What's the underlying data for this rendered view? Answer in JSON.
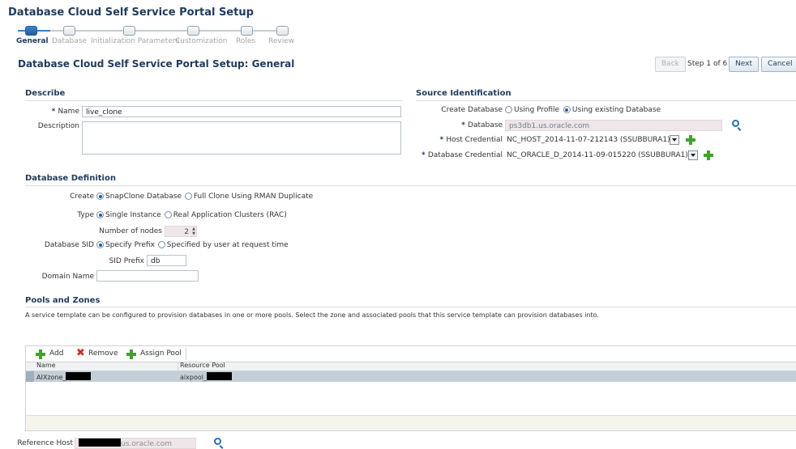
{
  "page": {
    "title": "Database Cloud Self Service Portal Setup",
    "subtitle": "Database Cloud Self Service Portal Setup: General"
  },
  "train": {
    "steps": [
      "General",
      "Database",
      "Initialization Parameters",
      "Customization",
      "Roles",
      "Review"
    ],
    "active": 0
  },
  "nav": {
    "back": "Back",
    "step": "Step 1 of 6",
    "next": "Next",
    "cancel": "Cancel"
  },
  "describe": {
    "heading": "Describe",
    "name_label": "Name",
    "name_value": "live_clone",
    "description_label": "Description",
    "description_value": ""
  },
  "source": {
    "heading": "Source Identification",
    "create_label": "Create Database",
    "opt_profile": "Using Profile",
    "opt_existing": "Using existing Database",
    "database_label": "Database",
    "database_value": "ps3db1.us.oracle.com",
    "host_cred_label": "Host Credential",
    "host_cred_value": "NC_HOST_2014-11-07-212143 (SSUBBURA1)",
    "db_cred_label": "Database Credential",
    "db_cred_value": "NC_ORACLE_D_2014-11-09-015220 (SSUBBURA1)"
  },
  "definition": {
    "heading": "Database Definition",
    "create_label": "Create",
    "create_opt1": "SnapClone Database",
    "create_opt2": "Full Clone Using RMAN Duplicate",
    "type_label": "Type",
    "type_opt1": "Single Instance",
    "type_opt2": "Real Application Clusters (RAC)",
    "nodes_label": "Number of nodes",
    "nodes_value": "2",
    "sid_label": "Database SID",
    "sid_opt1": "Specify Prefix",
    "sid_opt2": "Specified by user at request time",
    "sid_prefix_label": "SID Prefix",
    "sid_prefix_value": "db",
    "domain_label": "Domain Name",
    "domain_value": ""
  },
  "pools": {
    "heading": "Pools and Zones",
    "description": "A service template can be configured to provision databases in one or more pools. Select the zone and associated pools that this service template can provision databases into.",
    "add": "Add",
    "remove": "Remove",
    "assign": "Assign Pool",
    "col_name": "Name",
    "col_pool": "Resource Pool",
    "rows": [
      {
        "name": "AIXzone_",
        "pool": "aixpool_"
      }
    ],
    "ref_host_label": "Reference Host",
    "ref_host_value": "us.oracle.com"
  },
  "colors": {
    "accent": "#1d5f9f",
    "title": "#1f3b5c",
    "selected_row": "#c3ced6"
  },
  "icons": [
    "search-icon",
    "add-icon",
    "remove-icon",
    "dropdown-icon"
  ]
}
